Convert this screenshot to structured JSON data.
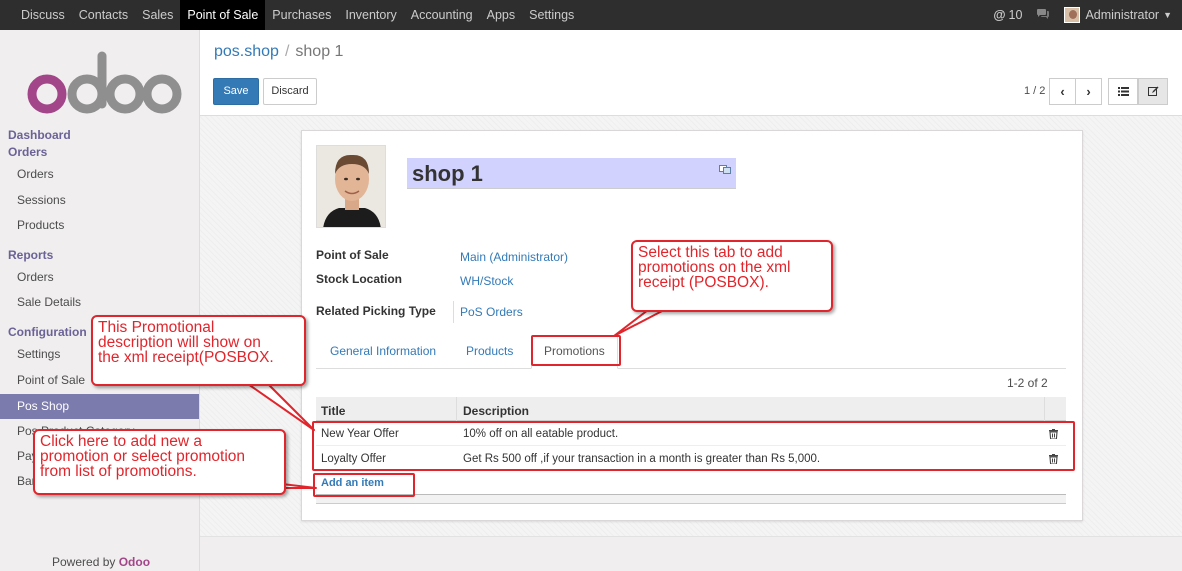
{
  "topbar": {
    "menu": [
      "Discuss",
      "Contacts",
      "Sales",
      "Point of Sale",
      "Purchases",
      "Inventory",
      "Accounting",
      "Apps",
      "Settings"
    ],
    "active_menu": "Point of Sale",
    "notification_count": "10",
    "user": "Administrator"
  },
  "sidebar": {
    "logo_text": "odoo",
    "dashboard": "Dashboard",
    "orders_section": "Orders",
    "orders_items": [
      "Orders",
      "Sessions",
      "Products"
    ],
    "reports_section": "Reports",
    "reports_items": [
      "Orders",
      "Sale Details"
    ],
    "config_section": "Configuration",
    "config_items": [
      "Settings",
      "Point of Sale",
      "Pos Shop",
      "Pos Product Category",
      "Payment Methods",
      "Bar Codes"
    ],
    "active_item": "Pos Shop",
    "powered_by": "Powered by",
    "powered_brand": "Odoo"
  },
  "breadcrumb": {
    "parent": "pos.shop",
    "separator": "/",
    "current": "shop 1"
  },
  "buttons": {
    "save": "Save",
    "discard": "Discard"
  },
  "pager": {
    "value": "1 / 2"
  },
  "form": {
    "name": "shop 1",
    "fields": [
      {
        "label": "Point of Sale",
        "value": "Main (Administrator)"
      },
      {
        "label": "Stock Location",
        "value": "WH/Stock"
      },
      {
        "label": "Related Picking Type",
        "value": "PoS Orders"
      }
    ],
    "tabs": [
      "General Information",
      "Products",
      "Promotions"
    ],
    "active_tab": "Promotions"
  },
  "promotions": {
    "count": "1-2 of 2",
    "columns": [
      "Title",
      "Description"
    ],
    "rows": [
      {
        "title": "New Year Offer",
        "description": "10% off on all eatable product."
      },
      {
        "title": "Loyalty Offer",
        "description": "Get Rs 500 off ,if your transaction in a month is greater than Rs 5,000."
      }
    ],
    "add_item": "Add an item"
  },
  "annotations": {
    "tab_note": [
      "Select this tab to add",
      "promotions on the xml",
      "receipt (POSBOX)."
    ],
    "desc_note": [
      "This Promotional",
      "description will show on",
      "the xml receipt(POSBOX."
    ],
    "add_note": [
      "Click here to add new a",
      "promotion or select promotion",
      "from list of promotions."
    ]
  },
  "colors": {
    "accent": "#7c7bad",
    "link": "#337ab7",
    "primary_button": "#337ab7",
    "annotation": "#e0262c",
    "name_field": "#d2d2ff",
    "brand": "#a24689"
  }
}
